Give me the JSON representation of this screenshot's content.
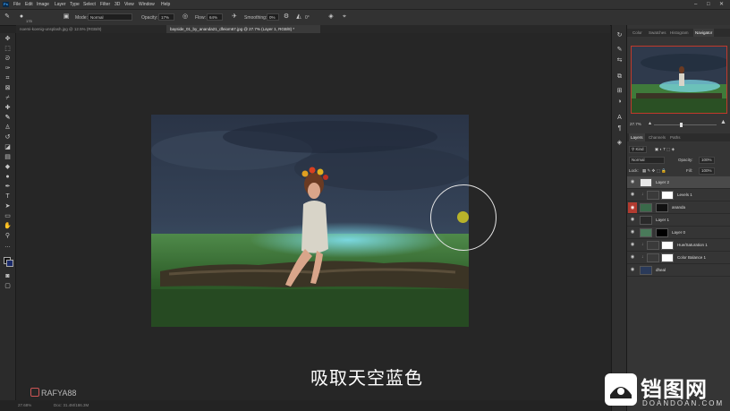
{
  "menubar": {
    "items": [
      "File",
      "Edit",
      "Image",
      "Layer",
      "Type",
      "Select",
      "Filter",
      "3D",
      "View",
      "Window",
      "Help"
    ]
  },
  "options": {
    "brush_size": "175",
    "mode_label": "Mode:",
    "mode_value": "Normal",
    "opacity_label": "Opacity:",
    "opacity_value": "17%",
    "flow_label": "Flow:",
    "flow_value": "64%",
    "smoothing_label": "Smoothing:",
    "smoothing_value": "0%",
    "angle_value": "0°"
  },
  "tabs": [
    {
      "label": "noemi-koenig-unsplash.jpg @ 12.5% (RGB/8)"
    },
    {
      "label": "bayside_01_by_ananda21_dfeiom67.jpg @ 27.7% (Layer 1, RGB/8) *"
    }
  ],
  "subtitle": "吸取天空蓝色",
  "watermark": "RAFYA88",
  "status": {
    "zoom": "27.68%",
    "doc": "Doc: 31.4M/186.3M"
  },
  "panel_tabs_top": [
    "Color",
    "Swatches",
    "Histogram",
    "Navigator"
  ],
  "navigator": {
    "zoom": "27.7%"
  },
  "panel_tabs_layers": [
    "Layers",
    "Channels",
    "Paths"
  ],
  "layers_controls": {
    "kind": "Kind",
    "blend": "Normal",
    "opacity_label": "Opacity:",
    "opacity_value": "100%",
    "lock_label": "Lock:",
    "fill_label": "Fill:",
    "fill_value": "100%"
  },
  "layers": [
    {
      "name": "Layer 2"
    },
    {
      "name": "Levels 1"
    },
    {
      "name": "ananda"
    },
    {
      "name": "Layer 1"
    },
    {
      "name": "Layer 0"
    },
    {
      "name": "Hue/Saturation 1"
    },
    {
      "name": "Color Balance 1"
    },
    {
      "name": "dheal"
    }
  ],
  "logo": {
    "cn": "铛图网",
    "en": "DOANDOAN.COM"
  }
}
